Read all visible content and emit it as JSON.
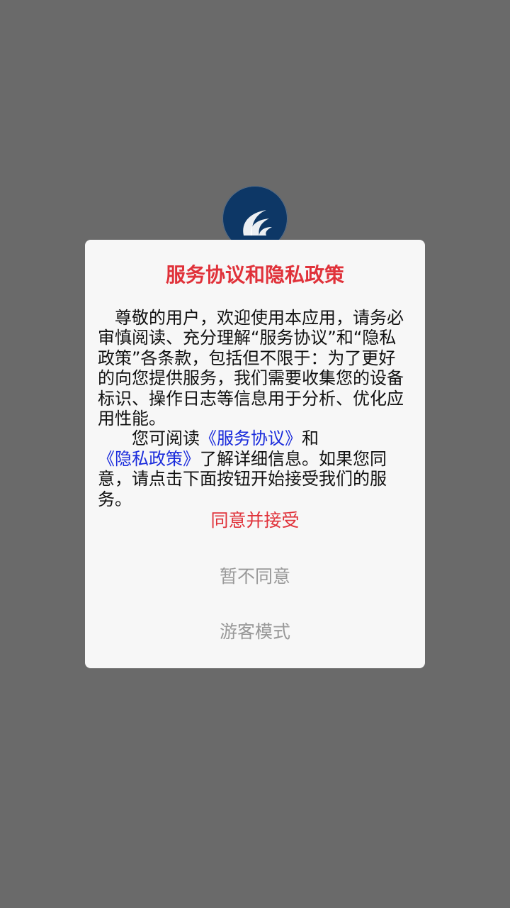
{
  "dialog": {
    "title": "服务协议和隐私政策",
    "body_paragraph1": "尊敬的用户，欢迎使用本应用，请务必审慎阅读、充分理解“服务协议”和“隐私政策”各条款，包括但不限于：为了更好的向您提供服务，我们需要收集您的设备标识、操作日志等信息用于分析、优化应用性能。",
    "body_paragraph2_prefix": "您可阅读",
    "service_agreement_link": "《服务协议》",
    "body_paragraph2_and": "和",
    "privacy_policy_link": "《隐私政策》",
    "body_paragraph2_suffix": "了解详细信息。如果您同意，请点击下面按钮开始接受我们的服务。",
    "agree_button": "同意并接受",
    "disagree_button": "暂不同意",
    "guest_button": "游客模式"
  },
  "colors": {
    "overlay": "#6a6a6a",
    "dialog_bg": "#f7f7f7",
    "accent_red": "#e0323a",
    "link_blue": "#1a2bdc",
    "muted_gray": "#999999",
    "logo_navy": "#0d3766"
  },
  "icons": {
    "app_logo": "app-logo-icon"
  }
}
